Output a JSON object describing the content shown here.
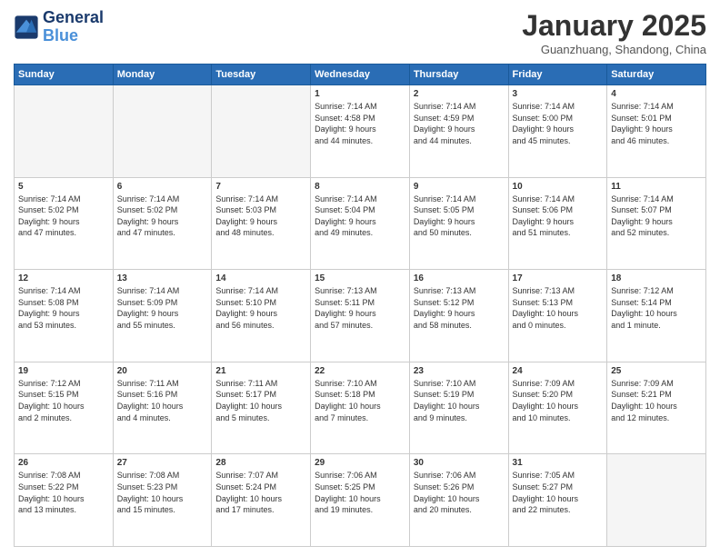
{
  "header": {
    "logo_line1": "General",
    "logo_line2": "Blue",
    "month": "January 2025",
    "location": "Guanzhuang, Shandong, China"
  },
  "weekdays": [
    "Sunday",
    "Monday",
    "Tuesday",
    "Wednesday",
    "Thursday",
    "Friday",
    "Saturday"
  ],
  "weeks": [
    [
      {
        "day": "",
        "info": ""
      },
      {
        "day": "",
        "info": ""
      },
      {
        "day": "",
        "info": ""
      },
      {
        "day": "1",
        "info": "Sunrise: 7:14 AM\nSunset: 4:58 PM\nDaylight: 9 hours\nand 44 minutes."
      },
      {
        "day": "2",
        "info": "Sunrise: 7:14 AM\nSunset: 4:59 PM\nDaylight: 9 hours\nand 44 minutes."
      },
      {
        "day": "3",
        "info": "Sunrise: 7:14 AM\nSunset: 5:00 PM\nDaylight: 9 hours\nand 45 minutes."
      },
      {
        "day": "4",
        "info": "Sunrise: 7:14 AM\nSunset: 5:01 PM\nDaylight: 9 hours\nand 46 minutes."
      }
    ],
    [
      {
        "day": "5",
        "info": "Sunrise: 7:14 AM\nSunset: 5:02 PM\nDaylight: 9 hours\nand 47 minutes."
      },
      {
        "day": "6",
        "info": "Sunrise: 7:14 AM\nSunset: 5:02 PM\nDaylight: 9 hours\nand 47 minutes."
      },
      {
        "day": "7",
        "info": "Sunrise: 7:14 AM\nSunset: 5:03 PM\nDaylight: 9 hours\nand 48 minutes."
      },
      {
        "day": "8",
        "info": "Sunrise: 7:14 AM\nSunset: 5:04 PM\nDaylight: 9 hours\nand 49 minutes."
      },
      {
        "day": "9",
        "info": "Sunrise: 7:14 AM\nSunset: 5:05 PM\nDaylight: 9 hours\nand 50 minutes."
      },
      {
        "day": "10",
        "info": "Sunrise: 7:14 AM\nSunset: 5:06 PM\nDaylight: 9 hours\nand 51 minutes."
      },
      {
        "day": "11",
        "info": "Sunrise: 7:14 AM\nSunset: 5:07 PM\nDaylight: 9 hours\nand 52 minutes."
      }
    ],
    [
      {
        "day": "12",
        "info": "Sunrise: 7:14 AM\nSunset: 5:08 PM\nDaylight: 9 hours\nand 53 minutes."
      },
      {
        "day": "13",
        "info": "Sunrise: 7:14 AM\nSunset: 5:09 PM\nDaylight: 9 hours\nand 55 minutes."
      },
      {
        "day": "14",
        "info": "Sunrise: 7:14 AM\nSunset: 5:10 PM\nDaylight: 9 hours\nand 56 minutes."
      },
      {
        "day": "15",
        "info": "Sunrise: 7:13 AM\nSunset: 5:11 PM\nDaylight: 9 hours\nand 57 minutes."
      },
      {
        "day": "16",
        "info": "Sunrise: 7:13 AM\nSunset: 5:12 PM\nDaylight: 9 hours\nand 58 minutes."
      },
      {
        "day": "17",
        "info": "Sunrise: 7:13 AM\nSunset: 5:13 PM\nDaylight: 10 hours\nand 0 minutes."
      },
      {
        "day": "18",
        "info": "Sunrise: 7:12 AM\nSunset: 5:14 PM\nDaylight: 10 hours\nand 1 minute."
      }
    ],
    [
      {
        "day": "19",
        "info": "Sunrise: 7:12 AM\nSunset: 5:15 PM\nDaylight: 10 hours\nand 2 minutes."
      },
      {
        "day": "20",
        "info": "Sunrise: 7:11 AM\nSunset: 5:16 PM\nDaylight: 10 hours\nand 4 minutes."
      },
      {
        "day": "21",
        "info": "Sunrise: 7:11 AM\nSunset: 5:17 PM\nDaylight: 10 hours\nand 5 minutes."
      },
      {
        "day": "22",
        "info": "Sunrise: 7:10 AM\nSunset: 5:18 PM\nDaylight: 10 hours\nand 7 minutes."
      },
      {
        "day": "23",
        "info": "Sunrise: 7:10 AM\nSunset: 5:19 PM\nDaylight: 10 hours\nand 9 minutes."
      },
      {
        "day": "24",
        "info": "Sunrise: 7:09 AM\nSunset: 5:20 PM\nDaylight: 10 hours\nand 10 minutes."
      },
      {
        "day": "25",
        "info": "Sunrise: 7:09 AM\nSunset: 5:21 PM\nDaylight: 10 hours\nand 12 minutes."
      }
    ],
    [
      {
        "day": "26",
        "info": "Sunrise: 7:08 AM\nSunset: 5:22 PM\nDaylight: 10 hours\nand 13 minutes."
      },
      {
        "day": "27",
        "info": "Sunrise: 7:08 AM\nSunset: 5:23 PM\nDaylight: 10 hours\nand 15 minutes."
      },
      {
        "day": "28",
        "info": "Sunrise: 7:07 AM\nSunset: 5:24 PM\nDaylight: 10 hours\nand 17 minutes."
      },
      {
        "day": "29",
        "info": "Sunrise: 7:06 AM\nSunset: 5:25 PM\nDaylight: 10 hours\nand 19 minutes."
      },
      {
        "day": "30",
        "info": "Sunrise: 7:06 AM\nSunset: 5:26 PM\nDaylight: 10 hours\nand 20 minutes."
      },
      {
        "day": "31",
        "info": "Sunrise: 7:05 AM\nSunset: 5:27 PM\nDaylight: 10 hours\nand 22 minutes."
      },
      {
        "day": "",
        "info": ""
      }
    ]
  ]
}
